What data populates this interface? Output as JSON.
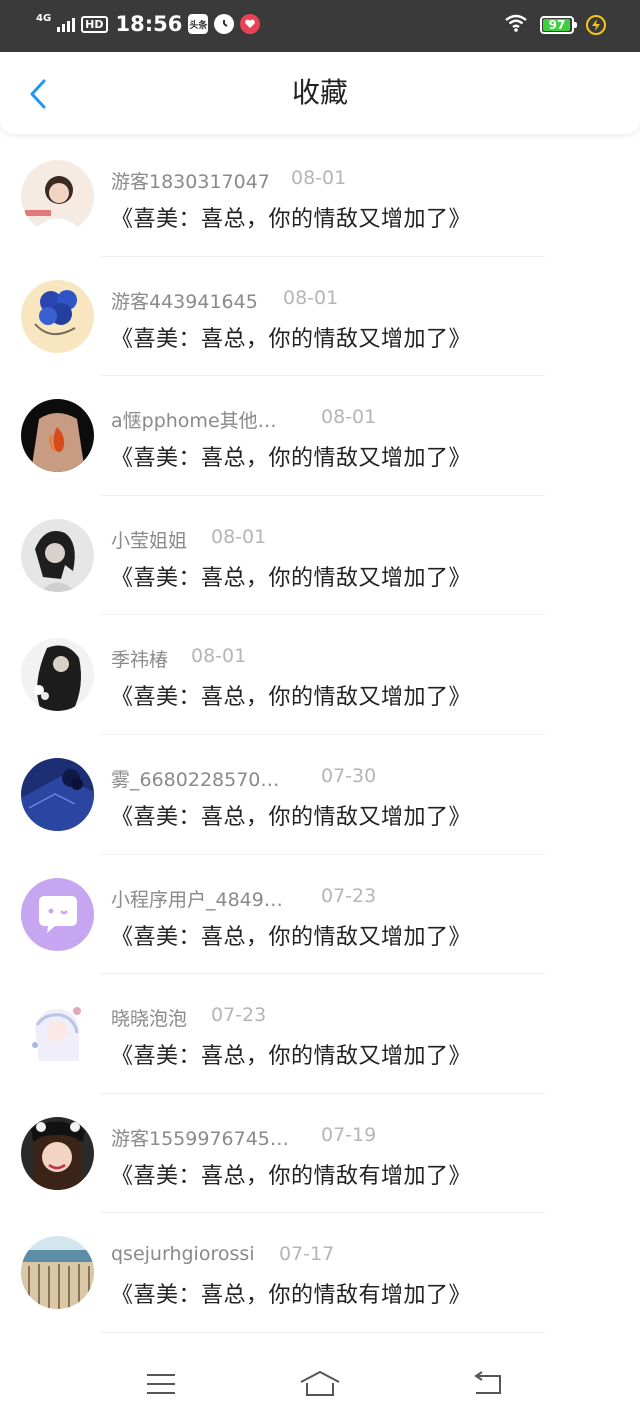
{
  "status_bar": {
    "network": "4G",
    "hd": "HD",
    "time": "18:56",
    "app_badge": "头条",
    "battery": "97",
    "icons": [
      "signal-icon",
      "hd-icon",
      "toutiao-icon",
      "clock-icon",
      "heart-icon",
      "wifi-icon",
      "battery-icon",
      "charging-icon"
    ]
  },
  "header": {
    "title": "收藏",
    "back_icon": "chevron-left-icon",
    "accent_color": "#2196f3"
  },
  "favorites": [
    {
      "user": "游客1830317047",
      "date": "08-01",
      "title": "《喜美：喜总，你的情敌又增加了》"
    },
    {
      "user": "游客443941645",
      "date": "08-01",
      "title": "《喜美：喜总，你的情敌又增加了》"
    },
    {
      "user": "a惬pphome其他…",
      "date": "08-01",
      "title": "《喜美：喜总，你的情敌又增加了》"
    },
    {
      "user": "小莹姐姐",
      "date": "08-01",
      "title": "《喜美：喜总，你的情敌又增加了》"
    },
    {
      "user": "季祎椿",
      "date": "08-01",
      "title": "《喜美：喜总，你的情敌又增加了》"
    },
    {
      "user": "雾_6680228570…",
      "date": "07-30",
      "title": "《喜美：喜总，你的情敌又增加了》"
    },
    {
      "user": "小程序用户_4849…",
      "date": "07-23",
      "title": "《喜美：喜总，你的情敌又增加了》"
    },
    {
      "user": "晓晓泡泡",
      "date": "07-23",
      "title": "《喜美：喜总，你的情敌又增加了》"
    },
    {
      "user": "游客1559976745…",
      "date": "07-19",
      "title": "《喜美：喜总，你的情敌有增加了》"
    },
    {
      "user": "qsejurhgiorossi",
      "date": "07-17",
      "title": "《喜美：喜总，你的情敌有增加了》"
    }
  ],
  "nav_bar": {
    "icons": [
      "menu-icon",
      "home-icon",
      "back-icon"
    ]
  }
}
